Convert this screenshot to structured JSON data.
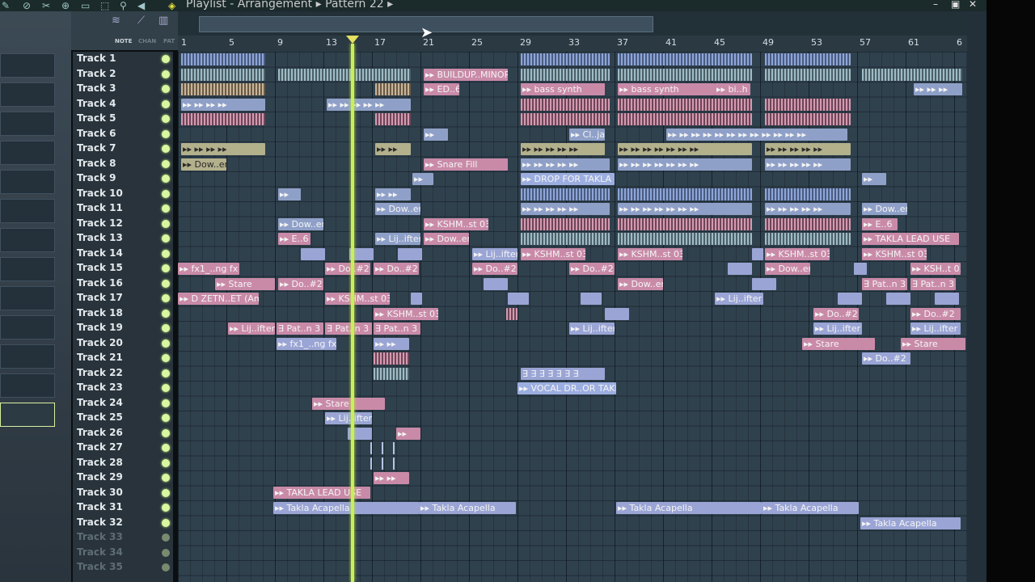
{
  "window": {
    "title": "Playlist - Arrangement",
    "pattern": "Pattern 22"
  },
  "toolbar": {
    "note_label": "NOTE",
    "chan_label": "CHAN",
    "pat_label": "PAT"
  },
  "ruler": {
    "ticks": [
      "1",
      "5",
      "9",
      "13",
      "17",
      "21",
      "25",
      "29",
      "33",
      "37",
      "41",
      "45",
      "49",
      "53",
      "57",
      "61",
      "6"
    ]
  },
  "tracks": [
    "Track 1",
    "Track 2",
    "Track 3",
    "Track 4",
    "Track 5",
    "Track 6",
    "Track 7",
    "Track 8",
    "Track 9",
    "Track 10",
    "Track 11",
    "Track 12",
    "Track 13",
    "Track 14",
    "Track 15",
    "Track 16",
    "Track 17",
    "Track 18",
    "Track 19",
    "Track 20",
    "Track 21",
    "Track 22",
    "Track 23",
    "Track 24",
    "Track 25",
    "Track 26",
    "Track 27",
    "Track 28",
    "Track 29",
    "Track 30",
    "Track 31",
    "Track 32",
    "Track 33",
    "Track 34",
    "Track 35"
  ],
  "clip_labels": {
    "buildup": "BUILDUP..MINOR",
    "ed6": "ED..6",
    "bass_synth": "bass synth",
    "bi_h": "bi..h",
    "clja": "Cl..ja",
    "dower": "Dow..er",
    "snare_fill": "Snare Fill",
    "drop": "DROP FOR TAKLA",
    "ksh03": "KSHM..st 03",
    "e6": "E..6",
    "liji": "Lij..ifter",
    "takla_lead": "TAKLA LEAD USE",
    "fx1": "fx1_..ng fx",
    "do2": "Do..#2",
    "ksh03b": "KSH..t 03",
    "stare": "Stare",
    "dzeten": "D ZETN..ET (Am)",
    "patn3": "Pat..n 3",
    "vocal": "VOCAL DR..OR TAKLA",
    "takla_acapella": "Takla Acapella"
  }
}
